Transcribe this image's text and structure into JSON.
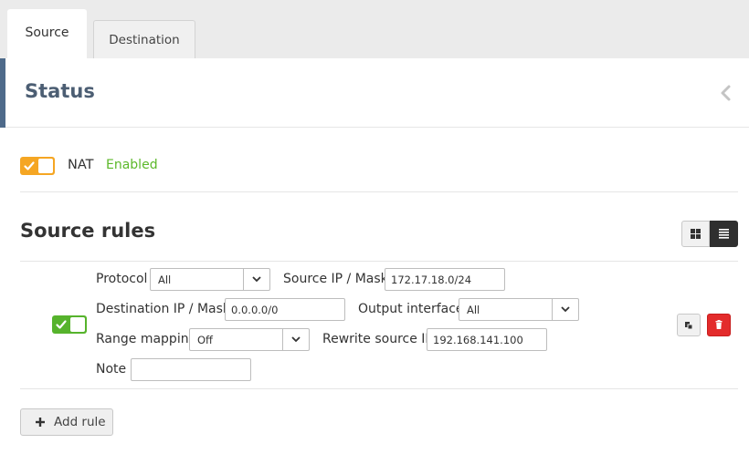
{
  "tabs": [
    {
      "label": "Source",
      "active": true
    },
    {
      "label": "Destination",
      "active": false
    }
  ],
  "status": {
    "title": "Status",
    "collapse_icon": "chevron-left-icon"
  },
  "nat": {
    "label": "NAT",
    "state": "Enabled",
    "toggle_on": true,
    "toggle_color": "#f5a623"
  },
  "source_rules": {
    "title": "Source rules",
    "view_icons": [
      "grid-view-icon",
      "list-view-icon"
    ],
    "rules": [
      {
        "enabled": true,
        "toggle_color": "#56b32c",
        "protocol_label": "Protocol",
        "protocol_value": "All",
        "source_ip_label": "Source IP / Mask",
        "source_ip_value": "172.17.18.0/24",
        "dest_ip_label": "Destination IP / Mask",
        "dest_ip_value": "0.0.0.0/0",
        "output_interface_label": "Output interface",
        "output_interface_value": "All",
        "range_mapping_label": "Range mapping",
        "range_mapping_value": "Off",
        "rewrite_source_ip_label": "Rewrite source IP",
        "rewrite_source_ip_value": "192.168.141.100",
        "note_label": "Note",
        "note_value": ""
      }
    ],
    "add_rule_label": "Add rule"
  },
  "colors": {
    "accent": "#4e6a8a",
    "enabled_text": "#5cb82a",
    "delete": "#e32b2b"
  }
}
